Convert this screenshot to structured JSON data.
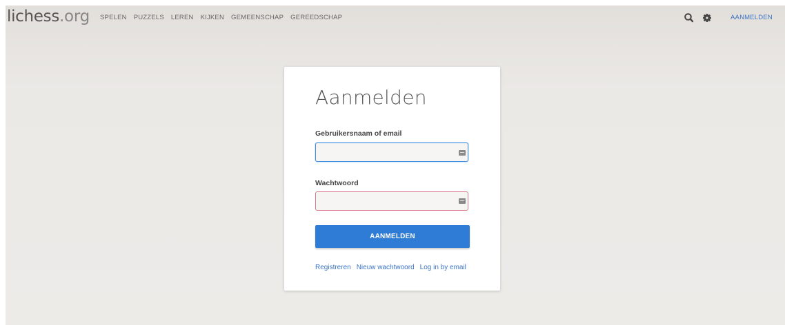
{
  "header": {
    "logo_main": "lichess",
    "logo_tld": ".org",
    "nav": [
      "SPELEN",
      "PUZZELS",
      "LEREN",
      "KIJKEN",
      "GEMEENSCHAP",
      "GEREEDSCHAP"
    ],
    "search_icon": "search-icon",
    "settings_icon": "gear-icon",
    "login_label": "AANMELDEN"
  },
  "form": {
    "title": "Aanmelden",
    "username_label": "Gebruikersnaam of email",
    "username_value": "",
    "password_label": "Wachtwoord",
    "password_value": "",
    "submit_label": "AANMELDEN",
    "links": {
      "register": "Registreren",
      "reset_password": "Nieuw wachtwoord",
      "email_login": "Log in by email"
    }
  },
  "colors": {
    "accent": "#2e7cd6",
    "link": "#3b73c6",
    "focus_border": "#3b8ee0",
    "invalid_border": "#d9778a"
  }
}
